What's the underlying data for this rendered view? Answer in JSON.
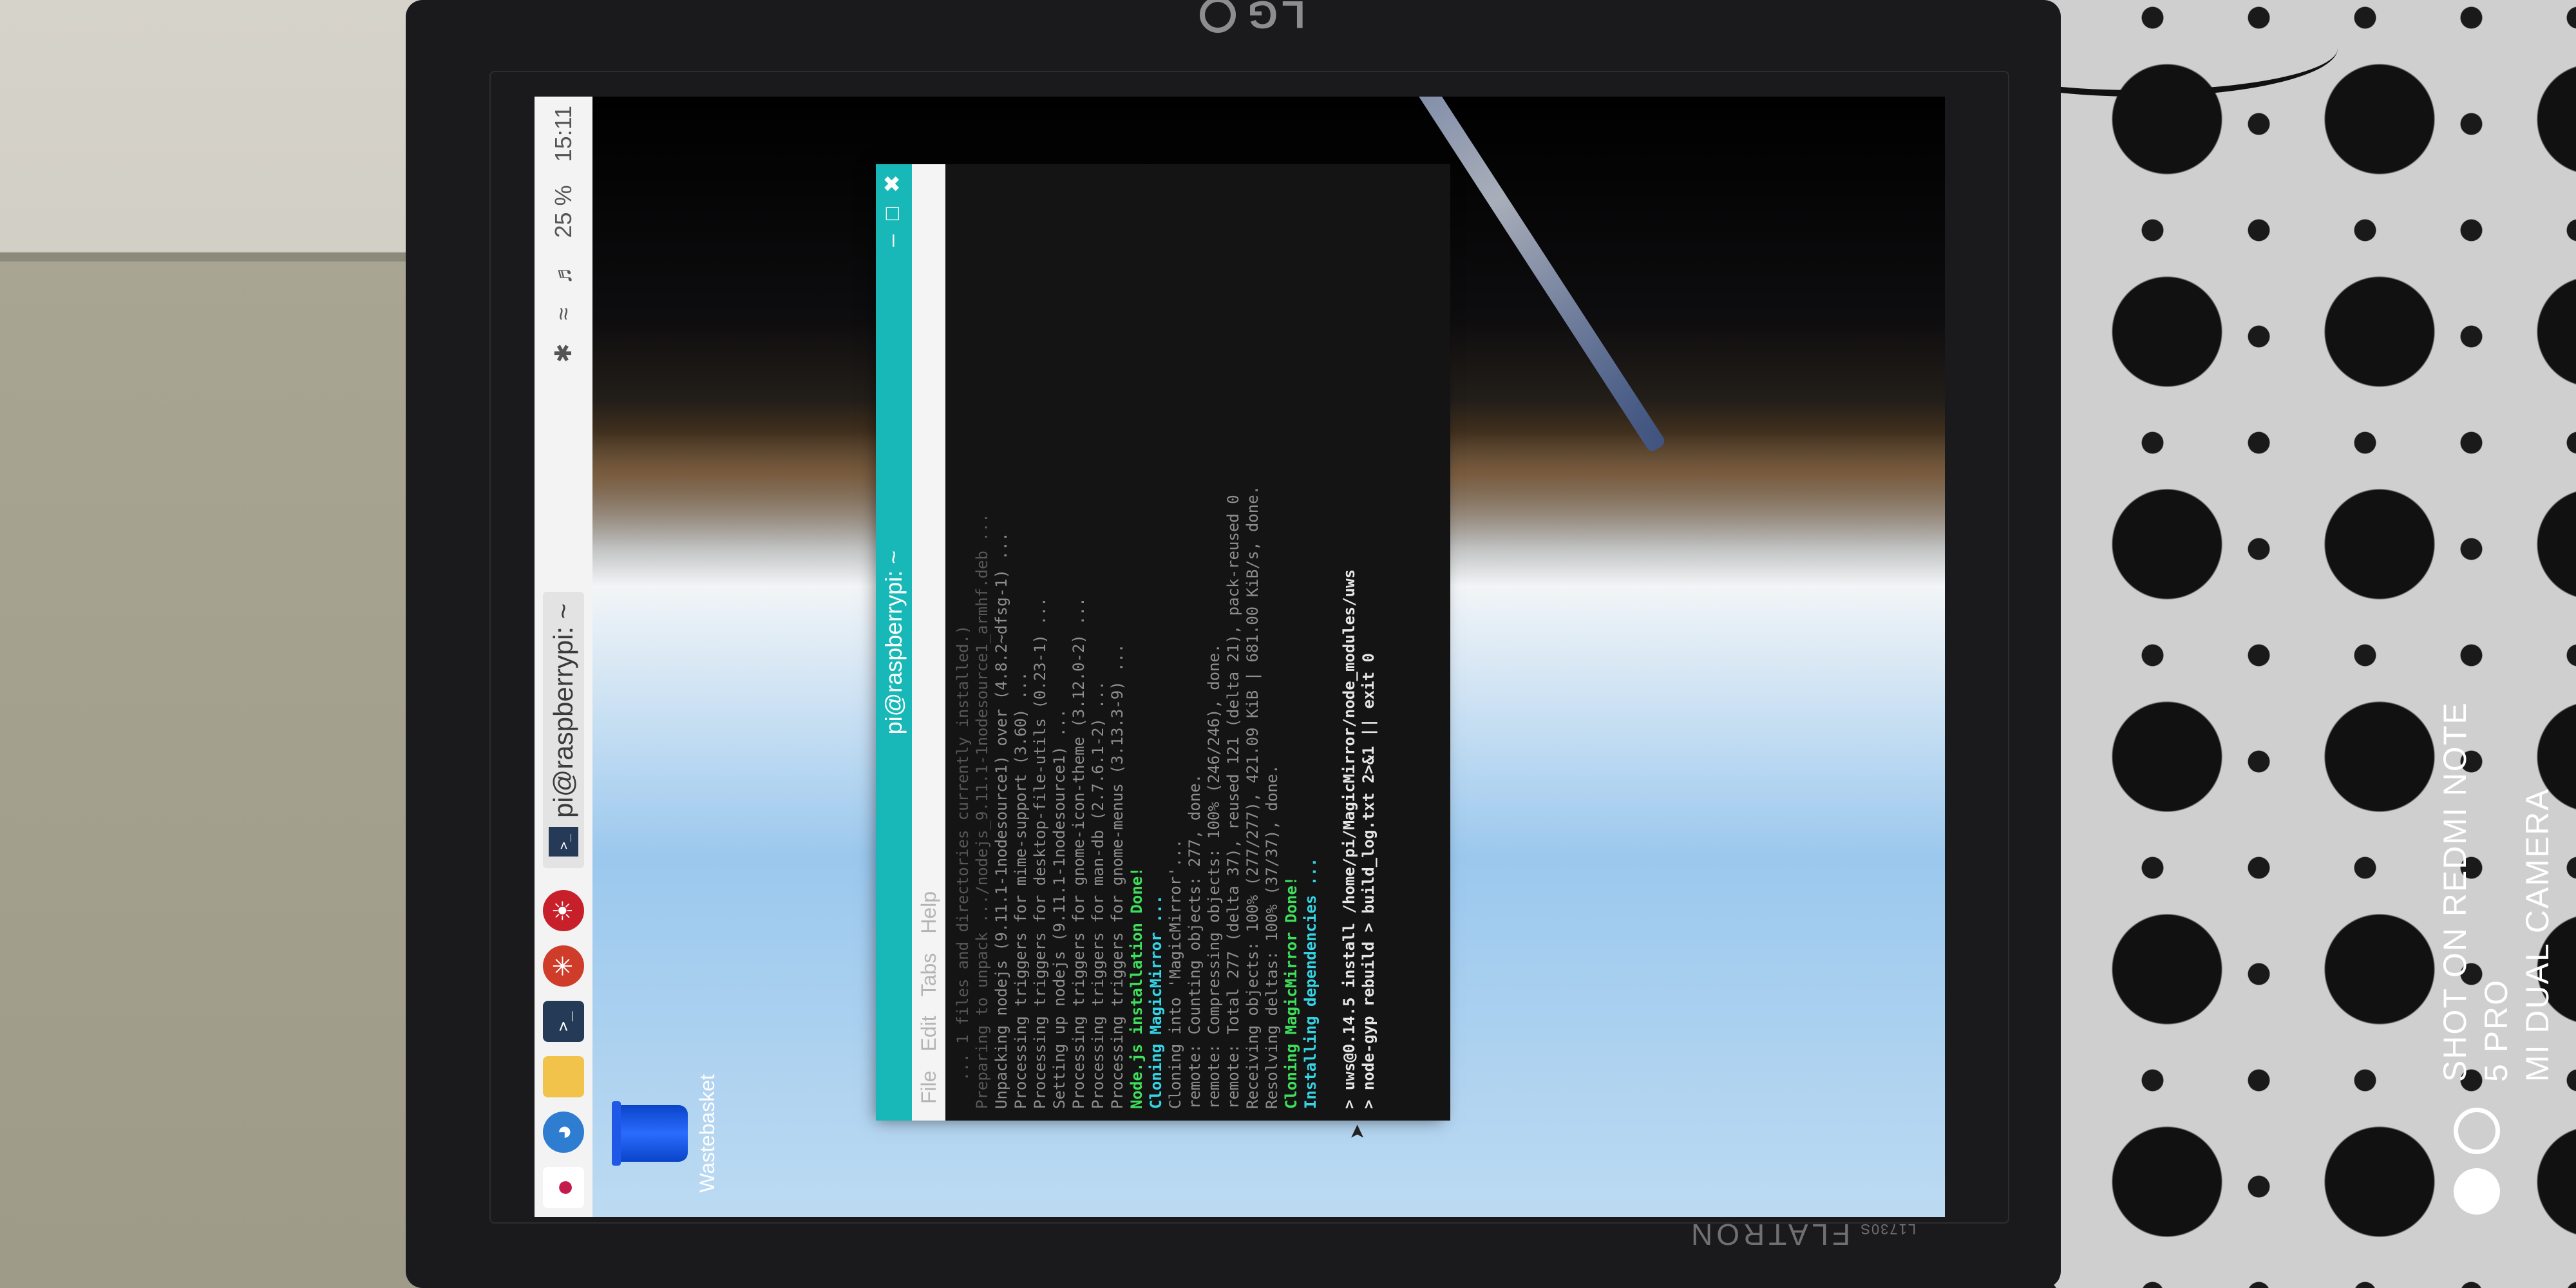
{
  "monitor": {
    "brand": "LG",
    "model_small": "L1730S",
    "model": "FLATRON"
  },
  "watermark": {
    "line1": "SHOT ON REDMI NOTE 5 PRO",
    "line2": "MI DUAL CAMERA"
  },
  "taskbar": {
    "icons": [
      "raspberry-menu-icon",
      "web-browser-icon",
      "file-manager-icon",
      "terminal-icon",
      "mathematica-icon",
      "wolfram-icon"
    ],
    "task_label": "pi@raspberrypi: ~",
    "tray": [
      "bluetooth-icon",
      "wifi-icon",
      "volume-icon",
      "25 %",
      "15:11"
    ]
  },
  "desktop": {
    "wastebasket_label": "Wastebasket"
  },
  "terminal": {
    "title": "pi@raspberrypi: ~",
    "menu": [
      "File",
      "Edit",
      "Tabs",
      "Help"
    ],
    "lines": [
      {
        "text": "   ... 1 files and directories currently installed.)",
        "style": "dim"
      },
      {
        "text": "Preparing to unpack .../nodejs_9.11.1-1nodesource1_armhf.deb ...",
        "style": "dim"
      },
      {
        "text": "Unpacking nodejs (9.11.1-1nodesource1) over (4.8.2~dfsg-1) ...",
        "style": "normal"
      },
      {
        "text": "Processing triggers for mime-support (3.60) ...",
        "style": "normal"
      },
      {
        "text": "Processing triggers for desktop-file-utils (0.23-1) ...",
        "style": "normal"
      },
      {
        "text": "Setting up nodejs (9.11.1-1nodesource1) ...",
        "style": "normal"
      },
      {
        "text": "Processing triggers for gnome-icon-theme (3.12.0-2) ...",
        "style": "normal"
      },
      {
        "text": "Processing triggers for man-db (2.7.6.1-2) ...",
        "style": "normal"
      },
      {
        "text": "Processing triggers for gnome-menus (3.13.3-9) ...",
        "style": "normal"
      },
      {
        "text": "Node.js installation Done!",
        "style": "green"
      },
      {
        "text": "Cloning MagicMirror ...",
        "style": "cyan"
      },
      {
        "text": "Cloning into 'MagicMirror'...",
        "style": "normal"
      },
      {
        "text": "remote: Counting objects: 277, done.",
        "style": "normal"
      },
      {
        "text": "remote: Compressing objects: 100% (246/246), done.",
        "style": "normal"
      },
      {
        "text": "remote: Total 277 (delta 37), reused 121 (delta 21), pack-reused 0",
        "style": "normal"
      },
      {
        "text": "Receiving objects: 100% (277/277), 421.09 KiB | 681.00 KiB/s, done.",
        "style": "normal"
      },
      {
        "text": "Resolving deltas: 100% (37/37), done.",
        "style": "normal"
      },
      {
        "text": "Cloning MagicMirror Done!",
        "style": "green"
      },
      {
        "text": "Installing dependencies ...",
        "style": "cyan"
      },
      {
        "text": "",
        "style": "normal"
      },
      {
        "text": "> uws@0.14.5 install /home/pi/MagicMirror/node_modules/uws",
        "style": "bold"
      },
      {
        "text": "> node-gyp rebuild > build_log.txt 2>&1 || exit 0",
        "style": "bold"
      }
    ]
  }
}
